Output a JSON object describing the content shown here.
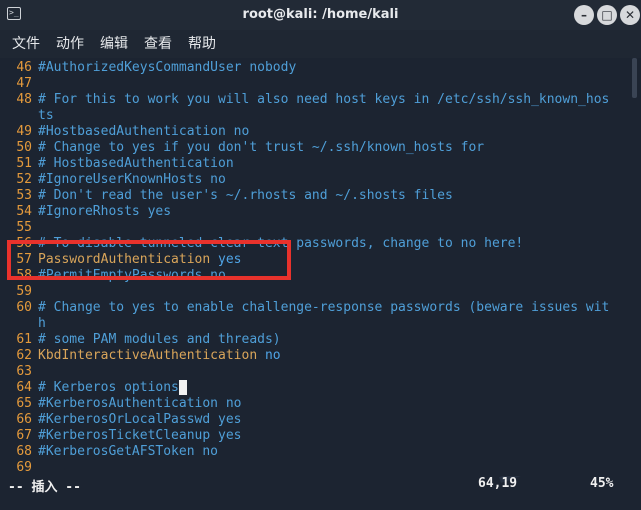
{
  "window": {
    "title": "root@kali: /home/kali",
    "app_icon_glyph": ">_",
    "controls": {
      "minimize": "–",
      "maximize": "□",
      "close": "✕"
    }
  },
  "menu": [
    "文件",
    "动作",
    "编辑",
    "查看",
    "帮助"
  ],
  "lines": [
    {
      "n": "46",
      "parts": [
        {
          "t": "#AuthorizedKeysCommandUser nobody",
          "c": "comment"
        }
      ]
    },
    {
      "n": "47",
      "parts": []
    },
    {
      "n": "48",
      "parts": [
        {
          "t": "# For this to work you will also need host keys in /etc/ssh/ssh_known_hos",
          "c": "comment"
        }
      ]
    },
    {
      "n": "",
      "parts": [
        {
          "t": "ts",
          "c": "comment"
        }
      ]
    },
    {
      "n": "49",
      "parts": [
        {
          "t": "#HostbasedAuthentication no",
          "c": "comment"
        }
      ]
    },
    {
      "n": "50",
      "parts": [
        {
          "t": "# Change to yes if you don't trust ~/.ssh/known_hosts for",
          "c": "comment"
        }
      ]
    },
    {
      "n": "51",
      "parts": [
        {
          "t": "# HostbasedAuthentication",
          "c": "comment"
        }
      ]
    },
    {
      "n": "52",
      "parts": [
        {
          "t": "#IgnoreUserKnownHosts no",
          "c": "comment"
        }
      ]
    },
    {
      "n": "53",
      "parts": [
        {
          "t": "# Don't read the user's ~/.rhosts and ~/.shosts files",
          "c": "comment"
        }
      ]
    },
    {
      "n": "54",
      "parts": [
        {
          "t": "#IgnoreRhosts yes",
          "c": "comment"
        }
      ]
    },
    {
      "n": "55",
      "parts": []
    },
    {
      "n": "56",
      "parts": [
        {
          "t": "# To disable tunneled clear text passwords, change to no here!",
          "c": "comment"
        }
      ]
    },
    {
      "n": "57",
      "parts": [
        {
          "t": "PasswordAuthentication",
          "c": "kw"
        },
        {
          "t": " yes",
          "c": "val"
        }
      ]
    },
    {
      "n": "58",
      "parts": [
        {
          "t": "#PermitEmptyPasswords no",
          "c": "comment"
        }
      ]
    },
    {
      "n": "59",
      "parts": []
    },
    {
      "n": "60",
      "parts": [
        {
          "t": "# Change to yes to enable challenge-response passwords (beware issues wit",
          "c": "comment"
        }
      ]
    },
    {
      "n": "",
      "parts": [
        {
          "t": "h",
          "c": "comment"
        }
      ]
    },
    {
      "n": "61",
      "parts": [
        {
          "t": "# some PAM modules and threads)",
          "c": "comment"
        }
      ]
    },
    {
      "n": "62",
      "parts": [
        {
          "t": "KbdInteractiveAuthentication",
          "c": "kw"
        },
        {
          "t": " no",
          "c": "val"
        }
      ]
    },
    {
      "n": "63",
      "parts": []
    },
    {
      "n": "64",
      "parts": [
        {
          "t": "# Kerberos options",
          "c": "comment"
        }
      ],
      "cursor": true
    },
    {
      "n": "65",
      "parts": [
        {
          "t": "#KerberosAuthentication no",
          "c": "comment"
        }
      ]
    },
    {
      "n": "66",
      "parts": [
        {
          "t": "#KerberosOrLocalPasswd yes",
          "c": "comment"
        }
      ]
    },
    {
      "n": "67",
      "parts": [
        {
          "t": "#KerberosTicketCleanup yes",
          "c": "comment"
        }
      ]
    },
    {
      "n": "68",
      "parts": [
        {
          "t": "#KerberosGetAFSToken no",
          "c": "comment"
        }
      ]
    },
    {
      "n": "69",
      "parts": []
    }
  ],
  "status": {
    "mode": "-- 插入 --",
    "position": "64,19",
    "percent": "45%"
  },
  "colors": {
    "background": "#1c2431",
    "line_number": "#e49a3c",
    "comment": "#4f9fd8",
    "keyword": "#d9a55a",
    "highlight_box": "#e8322c"
  }
}
